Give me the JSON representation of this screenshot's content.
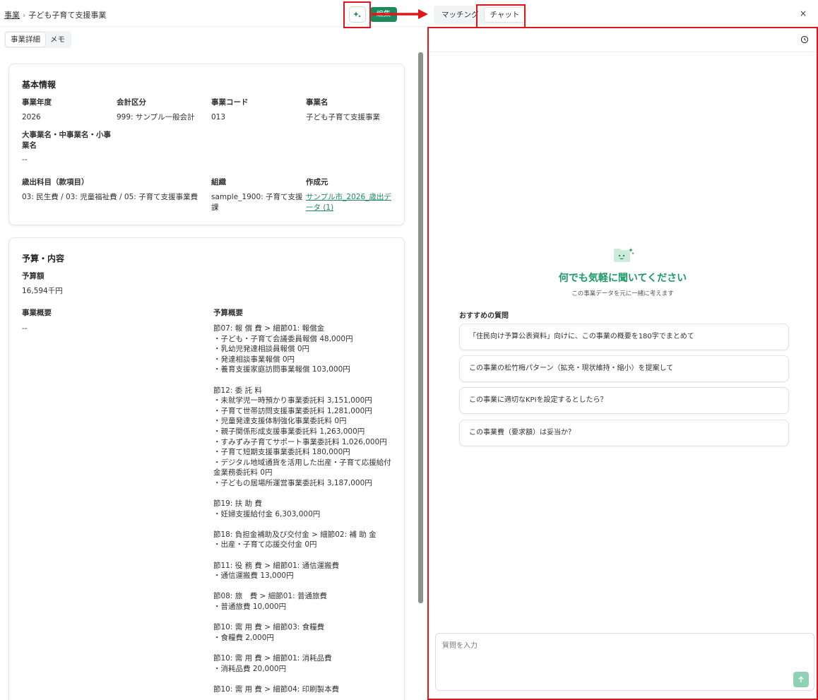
{
  "header": {
    "breadcrumb_root": "事業",
    "breadcrumb_sep": "›",
    "breadcrumb_current": "子ども子育て支援事業",
    "green_button_label": "編集"
  },
  "left_tabs": [
    "事業詳細",
    "メモ"
  ],
  "basic_info": {
    "title": "基本情報",
    "fiscal_year_label": "事業年度",
    "fiscal_year": "2026",
    "account_label": "会計区分",
    "account": "999: サンプル一般会計",
    "code_label": "事業コード",
    "code": "013",
    "name_label": "事業名",
    "name": "子ども子育て支援事業",
    "category_label_1": "大事業名・中事業名・小事",
    "category_label_2": "業名",
    "category_value": "--",
    "expense_label": "歳出科目（款項目）",
    "expense": "03: 民生費 / 03: 児童福祉費 / 05: 子育て支援事業費",
    "org_label": "組織",
    "org_1": "sample_1900: 子育て支援",
    "org_2": "課",
    "source_label": "作成元",
    "source_1": "サンプル市_2026_歳出デ",
    "source_2": "ータ (1)"
  },
  "budget": {
    "title": "予算・内容",
    "amount_label": "予算額",
    "amount": "16,594千円",
    "overview_label": "事業概要",
    "overview": "--",
    "budget_overview_label": "予算概要",
    "budget_overview": "節07: 報 償 費 > 細節01: 報償金\n・子ども・子育て会議委員報償 48,000円\n・乳幼児発達相談員報償 0円\n・発達相談事業報償 0円\n・養育支援家庭訪問事業報償 103,000円\n\n節12: 委 託 料\n・未就学児一時預かり事業委託料 3,151,000円\n・子育て世帯訪問支援事業委託料 1,281,000円\n・児童発達支援体制強化事業委託料 0円\n・親子関係形成支援事業委託料 1,263,000円\n・すみずみ子育てサポート事業委託料 1,026,000円\n・子育て短期支援事業委託料 180,000円\n・デジタル地域通貨を活用した出産・子育て応援給付\n金業務委託料 0円\n・子どもの居場所運営事業委託料 3,187,000円\n\n節19: 扶 助 費\n・妊婦支援給付金 6,303,000円\n\n節18: 負担金補助及び交付金 > 細節02: 補 助 金\n・出産・子育て応援交付金 0円\n\n節11: 役 務 費 > 細節01: 通信運搬費\n・通信運搬費 13,000円\n\n節08: 旅　費 > 細節01: 普通旅費\n・普通旅費 10,000円\n\n節10: 需 用 費 > 細節03: 食糧費\n・食糧費 2,000円\n\n節10: 需 用 費 > 細節01: 消耗品費\n・消耗品費 20,000円\n\n節10: 需 用 費 > 細節04: 印刷製本費"
  },
  "right_tabs": [
    "マッチング",
    "チャット"
  ],
  "close_label": "×",
  "chat": {
    "empty_title": "何でも気軽に聞いてください",
    "empty_subtitle": "この事業データを元に一緒に考えます",
    "suggestions_label": "おすすめの質問",
    "suggestions": [
      "「住民向け予算公表資料」向けに、この事業の概要を180字でまとめて",
      "この事業の松竹梅パターン（拡充・現状維持・縮小）を提案して",
      "この事業に適切なKPIを設定するとしたら？",
      "この事業費（要求額）は妥当か？"
    ],
    "input_placeholder": "質問を入力"
  },
  "colors": {
    "accent_green": "#1b8a5f",
    "highlight_red": "#e0161b"
  }
}
